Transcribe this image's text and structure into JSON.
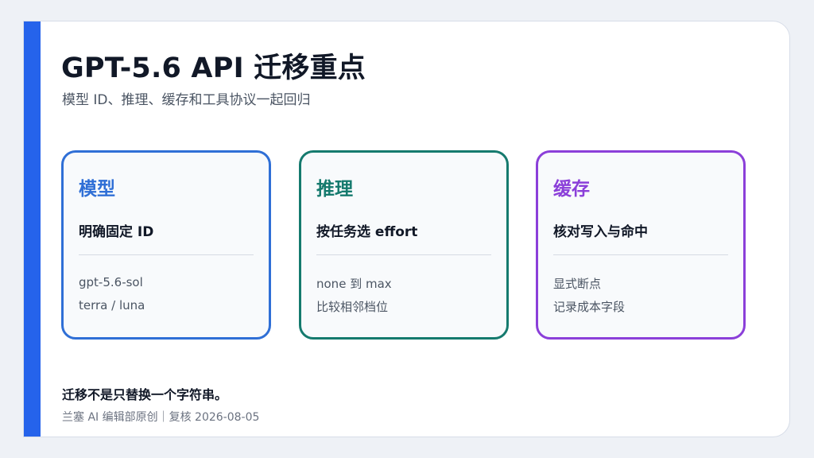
{
  "slide": {
    "title": "GPT-5.6 API 迁移重点",
    "subtitle": "模型 ID、推理、缓存和工具协议一起回归",
    "accent_color": "#2563eb",
    "cards": [
      {
        "heading": "模型",
        "subheading": "明确固定 ID",
        "lines": [
          "gpt-5.6-sol",
          "terra / luna"
        ],
        "color": "#2f6fd6"
      },
      {
        "heading": "推理",
        "subheading": "按任务选 effort",
        "lines": [
          "none 到 max",
          "比较相邻档位"
        ],
        "color": "#157a6e"
      },
      {
        "heading": "缓存",
        "subheading": "核对写入与命中",
        "lines": [
          "显式断点",
          "记录成本字段"
        ],
        "color": "#8b3fd9"
      }
    ],
    "footer_note": "迁移不是只替换一个字符串。",
    "footer_credit": "兰塞 AI 编辑部原创｜复核 2026-08-05"
  }
}
